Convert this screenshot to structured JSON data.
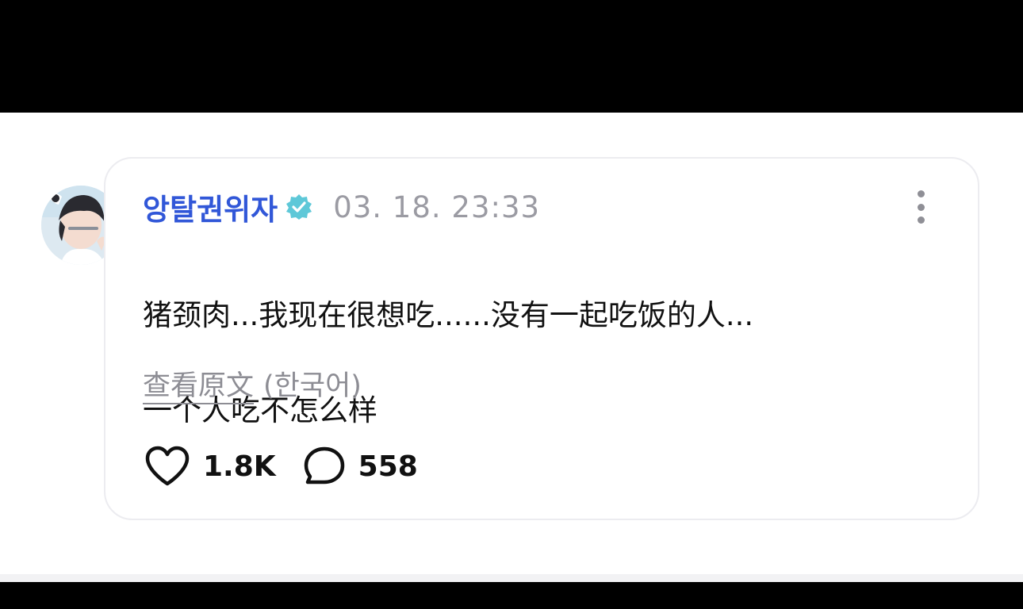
{
  "post": {
    "author": "앙탈권위자",
    "verified_icon": "verified-badge-icon",
    "timestamp": "03. 18. 23:33",
    "more_icon": "more-vertical-icon",
    "text_line_1": "猪颈肉...我现在很想吃......没有一起吃饭的人...",
    "text_line_2": "一个人吃不怎么样",
    "see_original_label": "查看原文",
    "original_language": "(한국어)",
    "likes_count": "1.8K",
    "comments_count": "558"
  },
  "colors": {
    "username": "#3157d8",
    "verified_badge": "#5ec8d8",
    "muted_text": "#8d8d94",
    "card_border": "#ececf0"
  }
}
